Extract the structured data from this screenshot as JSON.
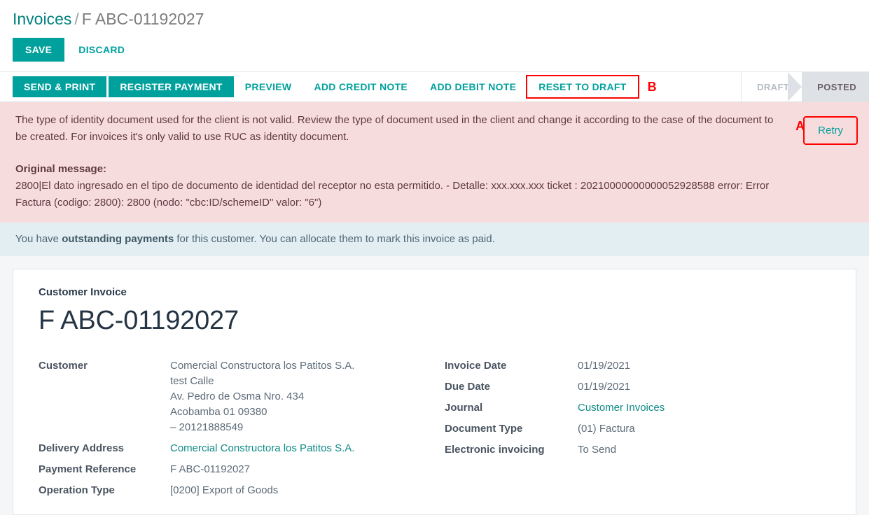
{
  "breadcrumb": {
    "root": "Invoices",
    "separator": "/",
    "current": "F ABC-01192027"
  },
  "toolbar": {
    "save_label": "SAVE",
    "discard_label": "DISCARD"
  },
  "statusbar": {
    "buttons": [
      {
        "label": "SEND & PRINT",
        "style": "primary",
        "name": "send-and-print-button"
      },
      {
        "label": "REGISTER PAYMENT",
        "style": "primary",
        "name": "register-payment-button"
      },
      {
        "label": "PREVIEW",
        "style": "link",
        "name": "preview-button"
      },
      {
        "label": "ADD CREDIT NOTE",
        "style": "link",
        "name": "add-credit-note-button"
      },
      {
        "label": "ADD DEBIT NOTE",
        "style": "link",
        "name": "add-debit-note-button"
      },
      {
        "label": "RESET TO DRAFT",
        "style": "link",
        "name": "reset-to-draft-button"
      }
    ],
    "annotation_b": "B",
    "states": [
      {
        "label": "DRAFT",
        "active": false
      },
      {
        "label": "POSTED",
        "active": true
      }
    ]
  },
  "error_alert": {
    "message": "The type of identity document used for the client is not valid. Review the type of document used in the client and change it according to the case of the document to be created. For invoices it's only valid to use RUC as identity document.",
    "original_label": "Original message:",
    "original_message": "2800|El dato ingresado en el tipo de documento de identidad del receptor no esta permitido. - Detalle: xxx.xxx.xxx ticket : 20210000000000052928588 error: Error Factura (codigo: 2800): 2800 (nodo: \"cbc:ID/schemeID\" valor: \"6\")",
    "retry_label": "Retry",
    "annotation_a": "A"
  },
  "info_alert": {
    "text_before": "You have ",
    "text_bold": "outstanding payments",
    "text_after": " for this customer. You can allocate them to mark this invoice as paid."
  },
  "invoice": {
    "subtitle": "Customer Invoice",
    "title": "F ABC-01192027",
    "left_fields": [
      {
        "label": "Customer",
        "value_lines": [
          "Comercial Constructora los Patitos S.A.",
          "test Calle",
          "Av. Pedro de Osma Nro. 434",
          "Acobamba 01 09380",
          "– 20121888549"
        ],
        "first_line_is_link": true
      },
      {
        "label": "Delivery Address",
        "value_lines": [
          "Comercial Constructora los Patitos S.A."
        ],
        "first_line_is_link": true
      },
      {
        "label": "Payment Reference",
        "value_lines": [
          "F ABC-01192027"
        ],
        "first_line_is_link": false
      },
      {
        "label": "Operation Type",
        "value_lines": [
          "[0200] Export of Goods"
        ],
        "first_line_is_link": false
      }
    ],
    "right_fields": [
      {
        "label": "Invoice Date",
        "value": "01/19/2021",
        "is_link": false
      },
      {
        "label": "Due Date",
        "value": "01/19/2021",
        "is_link": false
      },
      {
        "label": "Journal",
        "value": "Customer Invoices",
        "is_link": true
      },
      {
        "label": "Document Type",
        "value": "(01) Factura",
        "is_link": false
      },
      {
        "label": "Electronic invoicing",
        "value": "To Send",
        "is_link": false
      }
    ]
  },
  "colors": {
    "accent_teal": "#00a09d",
    "link_teal": "#0e8a87",
    "danger_bg": "#f7dcdd",
    "info_bg": "#e3eef3",
    "annotation_red": "#ff0000",
    "state_active_bg": "#dee2e6"
  }
}
